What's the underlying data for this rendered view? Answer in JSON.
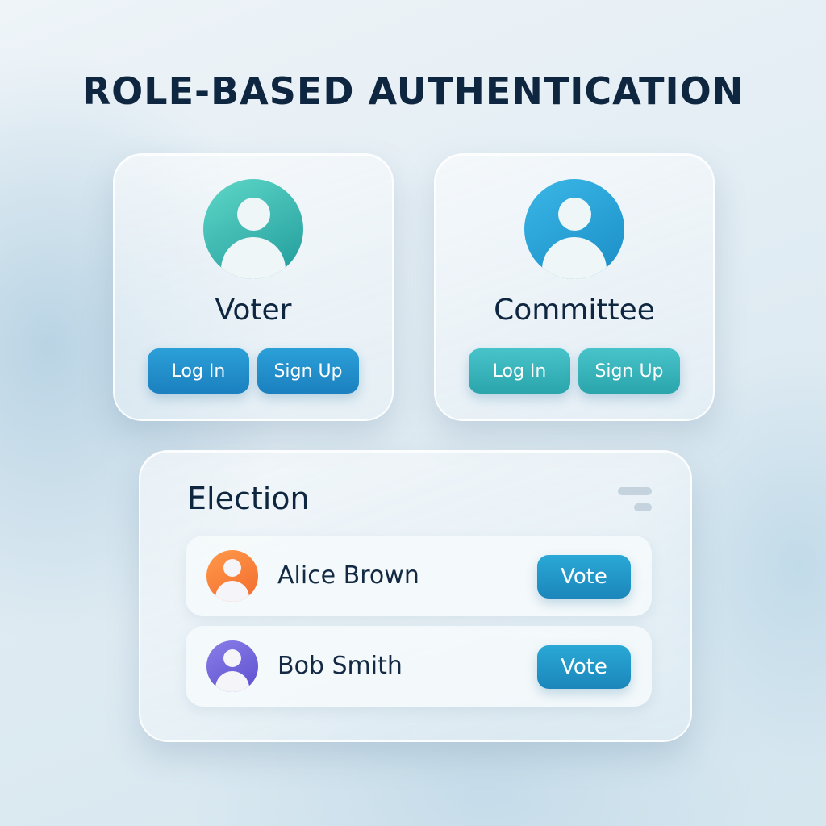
{
  "page": {
    "title": "ROLE-BASED AUTHENTICATION"
  },
  "roles": [
    {
      "name": "Voter",
      "login_label": "Log In",
      "signup_label": "Sign Up",
      "avatar_color": "#2aaea8",
      "button_color": "#1f8ccb"
    },
    {
      "name": "Committee",
      "login_label": "Log In",
      "signup_label": "Sign Up",
      "avatar_color": "#2496d3",
      "button_color": "#36b4bb"
    }
  ],
  "election": {
    "title": "Election",
    "candidates": [
      {
        "name": "Alice Brown",
        "vote_label": "Vote",
        "avatar_color": "#f47c38"
      },
      {
        "name": "Bob Smith",
        "vote_label": "Vote",
        "avatar_color": "#6c5fd8"
      }
    ]
  },
  "icons": [
    "user-avatar-icon",
    "menu-icon"
  ]
}
